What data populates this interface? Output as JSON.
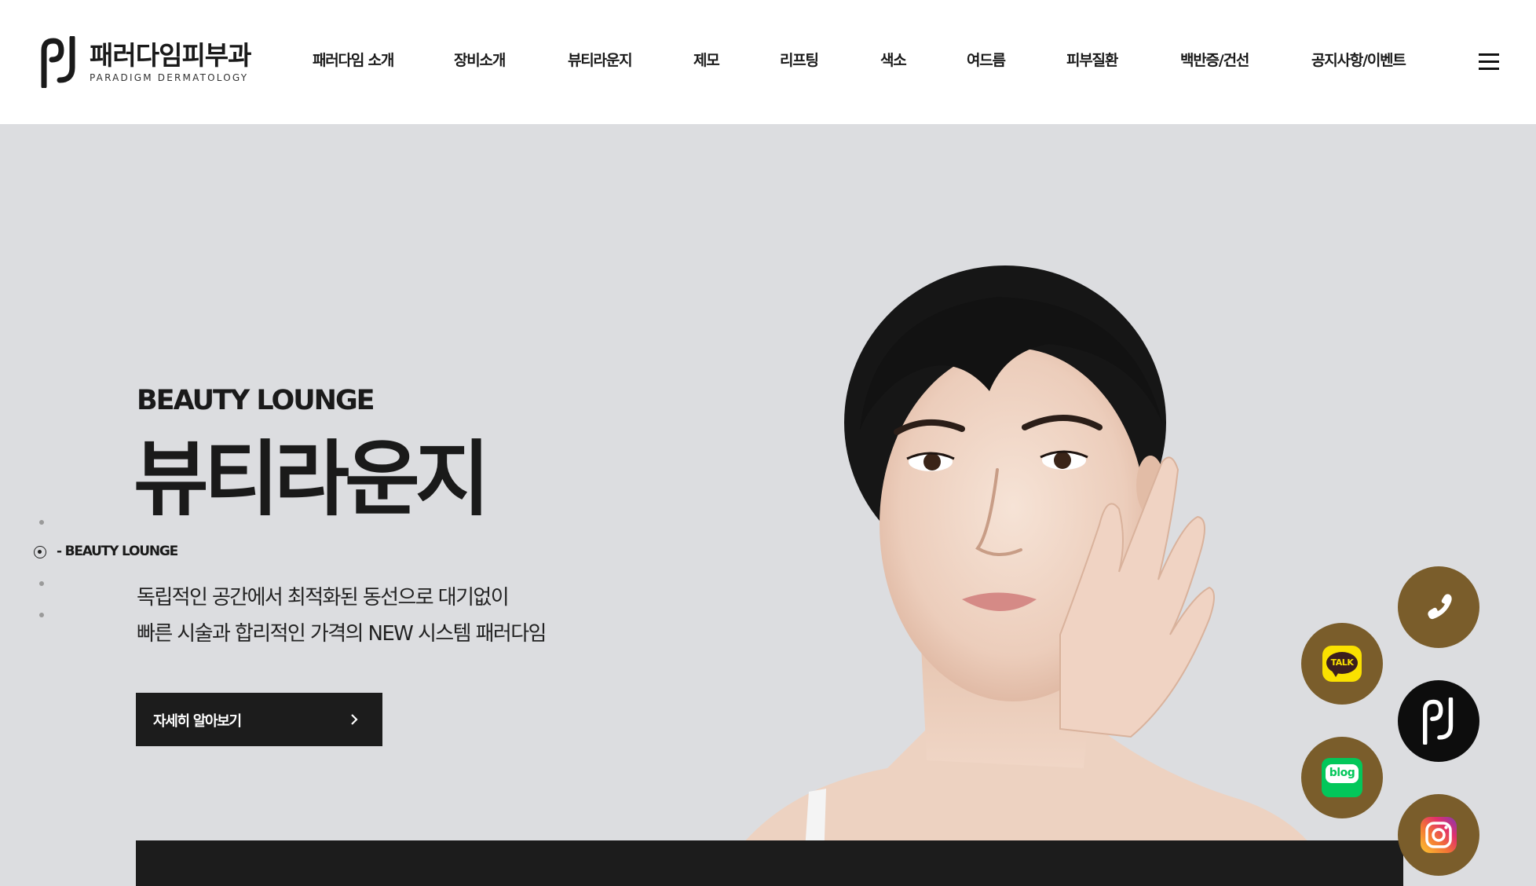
{
  "brand": {
    "name_ko": "패러다임피부과",
    "name_en": "PARADIGM DERMATOLOGY"
  },
  "nav": {
    "items": [
      {
        "label": "패러다임 소개"
      },
      {
        "label": "장비소개"
      },
      {
        "label": "뷰티라운지"
      },
      {
        "label": "제모"
      },
      {
        "label": "리프팅"
      },
      {
        "label": "색소"
      },
      {
        "label": "여드름"
      },
      {
        "label": "피부질환"
      },
      {
        "label": "백반증/건선"
      },
      {
        "label": "공지사항/이벤트"
      }
    ],
    "menu_icon": "hamburger-icon"
  },
  "hero": {
    "subtitle": "BEAUTY LOUNGE",
    "title": "뷰티라운지",
    "description_line1": "독립적인 공간에서 최적화된 동선으로 대기없이",
    "description_line2": "빠른 시술과 합리적인 가격의 NEW 시스템 패러다임",
    "cta_label": "자세히 알아보기",
    "cta_icon": "chevron-right-icon"
  },
  "pager": {
    "active_label": "- BEAUTY LOUNGE",
    "active_index": 1,
    "count": 4
  },
  "floating": {
    "phone_icon": "phone-icon",
    "kakao_label": "TALK",
    "blog_label": "blog",
    "brand_icon": "paradigm-logo-icon",
    "instagram_icon": "instagram-icon"
  },
  "colors": {
    "gold": "#7a5d2b",
    "dark": "#1c1c1c",
    "hero_bg": "#dcdde0",
    "kakao_yellow": "#fae100",
    "naver_green": "#03c75a"
  }
}
